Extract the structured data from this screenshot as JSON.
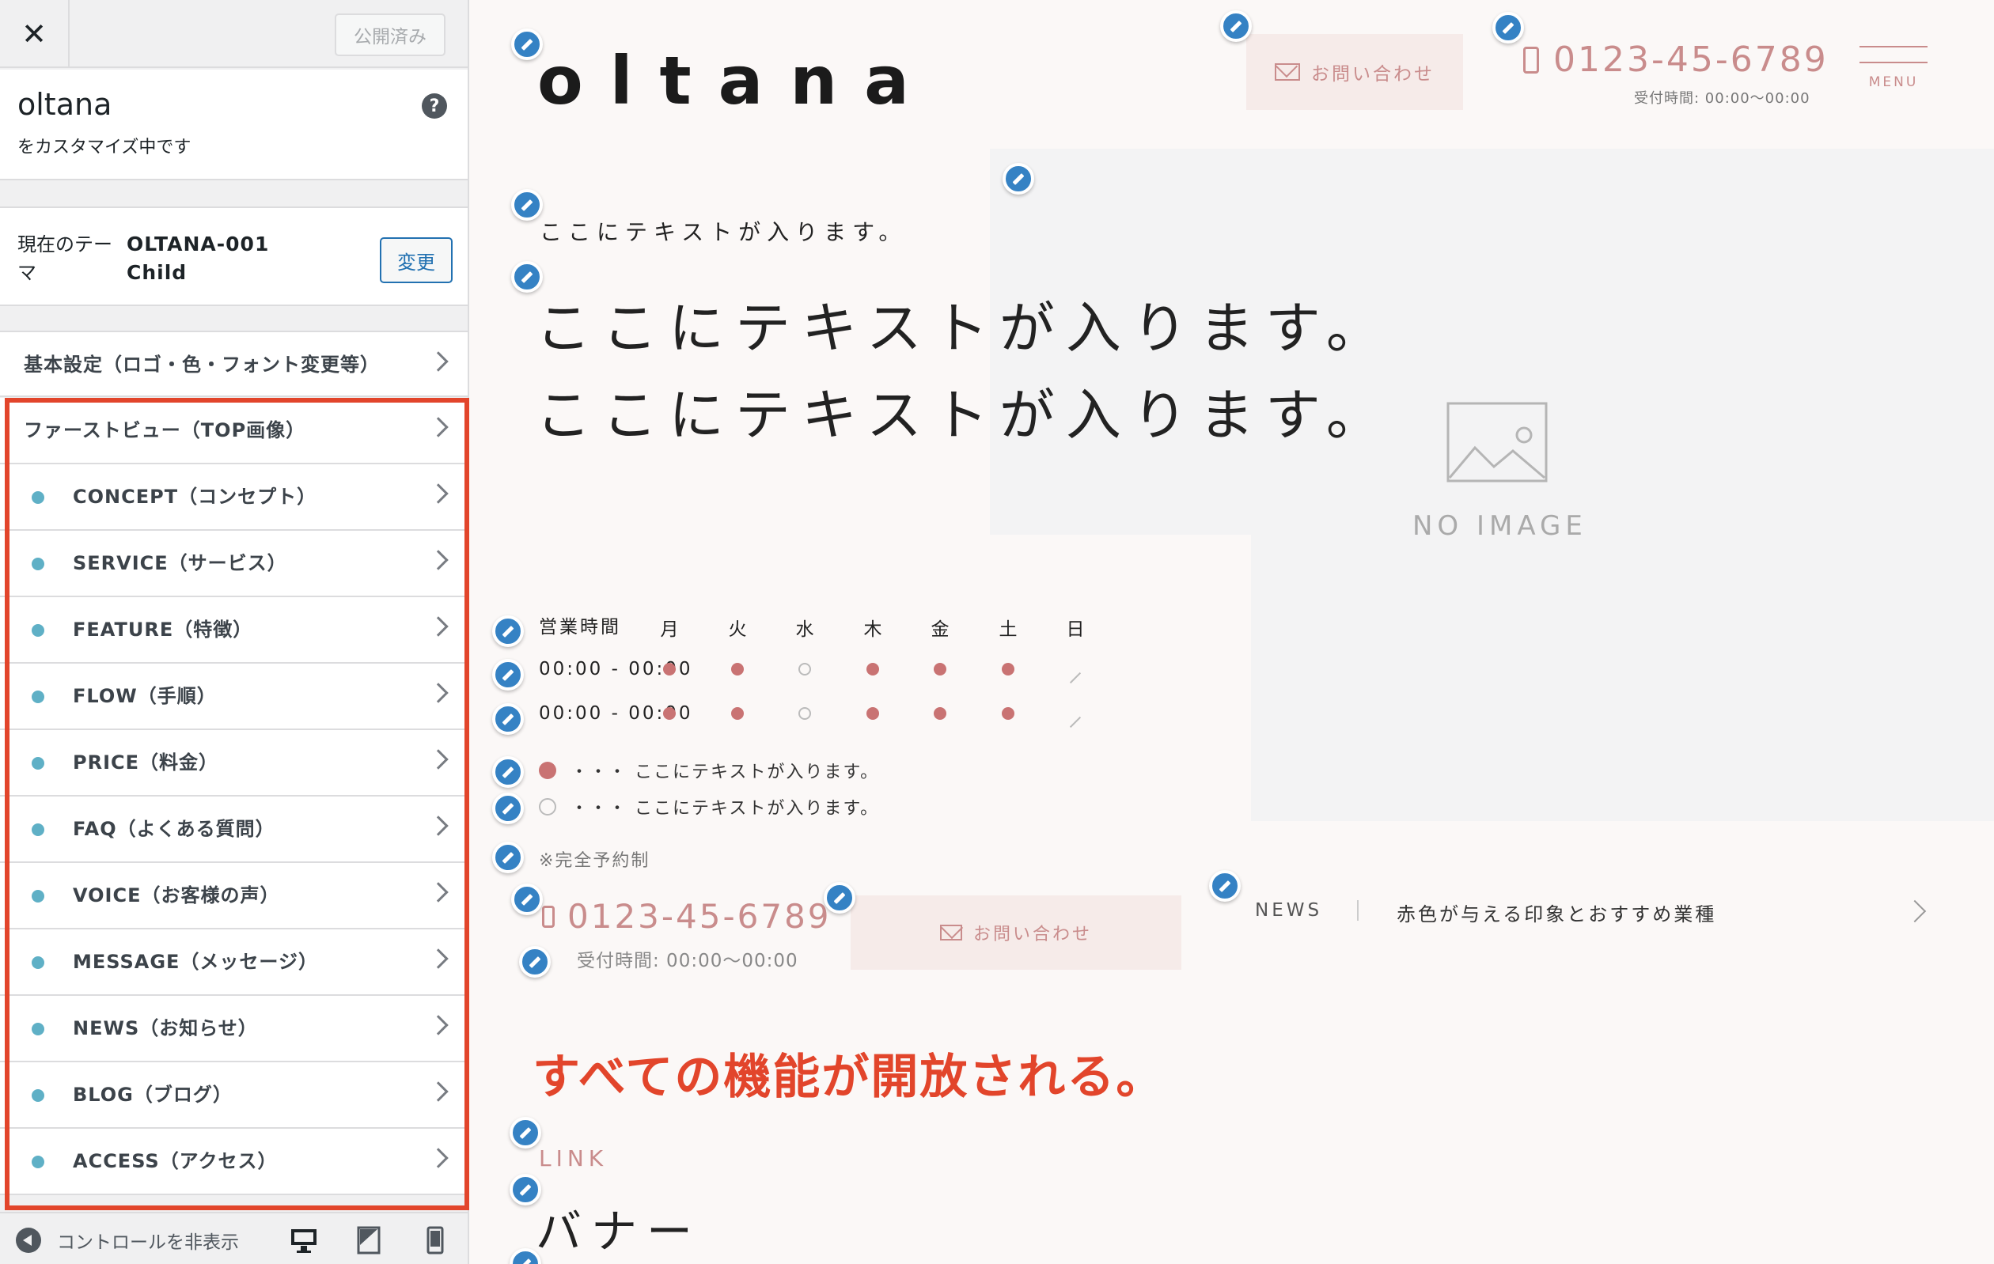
{
  "sidebar": {
    "close_label": "✕",
    "publish_label": "公開済み",
    "site_name": "oltana",
    "site_subtitle": "をカスタマイズ中です",
    "help_label": "?",
    "theme": {
      "current_label": "現在のテーマ",
      "name": "OLTANA-001 Child",
      "change_label": "変更"
    },
    "sections": [
      {
        "label": "基本設定（ロゴ・色・フォント変更等）"
      },
      {
        "label": "ファーストビュー（TOP画像）"
      }
    ],
    "subsections": [
      {
        "label": "CONCEPT（コンセプト）"
      },
      {
        "label": "SERVICE（サービス）"
      },
      {
        "label": "FEATURE（特徴）"
      },
      {
        "label": "FLOW（手順）"
      },
      {
        "label": "PRICE（料金）"
      },
      {
        "label": "FAQ（よくある質問）"
      },
      {
        "label": "VOICE（お客様の声）"
      },
      {
        "label": "MESSAGE（メッセージ）"
      },
      {
        "label": "NEWS（お知らせ）"
      },
      {
        "label": "BLOG（ブログ）"
      },
      {
        "label": "ACCESS（アクセス）"
      }
    ],
    "footer": {
      "hide_controls_label": "コントロールを非表示"
    },
    "colors": {
      "highlight": "#e2452b",
      "dot": "#5fb0c6",
      "accent": "#2271b1"
    }
  },
  "preview": {
    "logo": "oltana",
    "header": {
      "contact_label": "お問い合わせ",
      "phone": "0123-45-6789",
      "hours": "受付時間: 00:00〜00:00",
      "menu_label": "MENU"
    },
    "hero": {
      "small_text": "ここにテキストが入ります。",
      "big_line1": "ここにテキストが入ります。",
      "big_line2": "ここにテキストが入ります。",
      "no_image_label": "NO IMAGE"
    },
    "hours_table": {
      "header_label": "営業時間",
      "days": [
        "月",
        "火",
        "水",
        "木",
        "金",
        "土",
        "日"
      ],
      "rows": [
        {
          "time": "00:00 - 00:00",
          "status": [
            "open",
            "open",
            "partial",
            "open",
            "open",
            "open",
            "closed"
          ]
        },
        {
          "time": "00:00 - 00:00",
          "status": [
            "open",
            "open",
            "partial",
            "open",
            "open",
            "open",
            "closed"
          ]
        }
      ],
      "legend": [
        {
          "mark": "filled",
          "text": "・・・ ここにテキストが入ります。"
        },
        {
          "mark": "outline",
          "text": "・・・ ここにテキストが入ります。"
        }
      ],
      "note": "※完全予約制"
    },
    "contact": {
      "phone": "0123-45-6789",
      "hours": "受付時間: 00:00〜00:00",
      "contact_label": "お問い合わせ"
    },
    "news": {
      "label": "NEWS",
      "title": "赤色が与える印象とおすすめ業種"
    },
    "annotation": "すべての機能が開放される。",
    "link_label": "LINK",
    "banner_label": "バナー",
    "colors": {
      "accent": "#c98c8c",
      "contact_bg": "#f6ebe9",
      "pencil": "#3582c4"
    }
  }
}
